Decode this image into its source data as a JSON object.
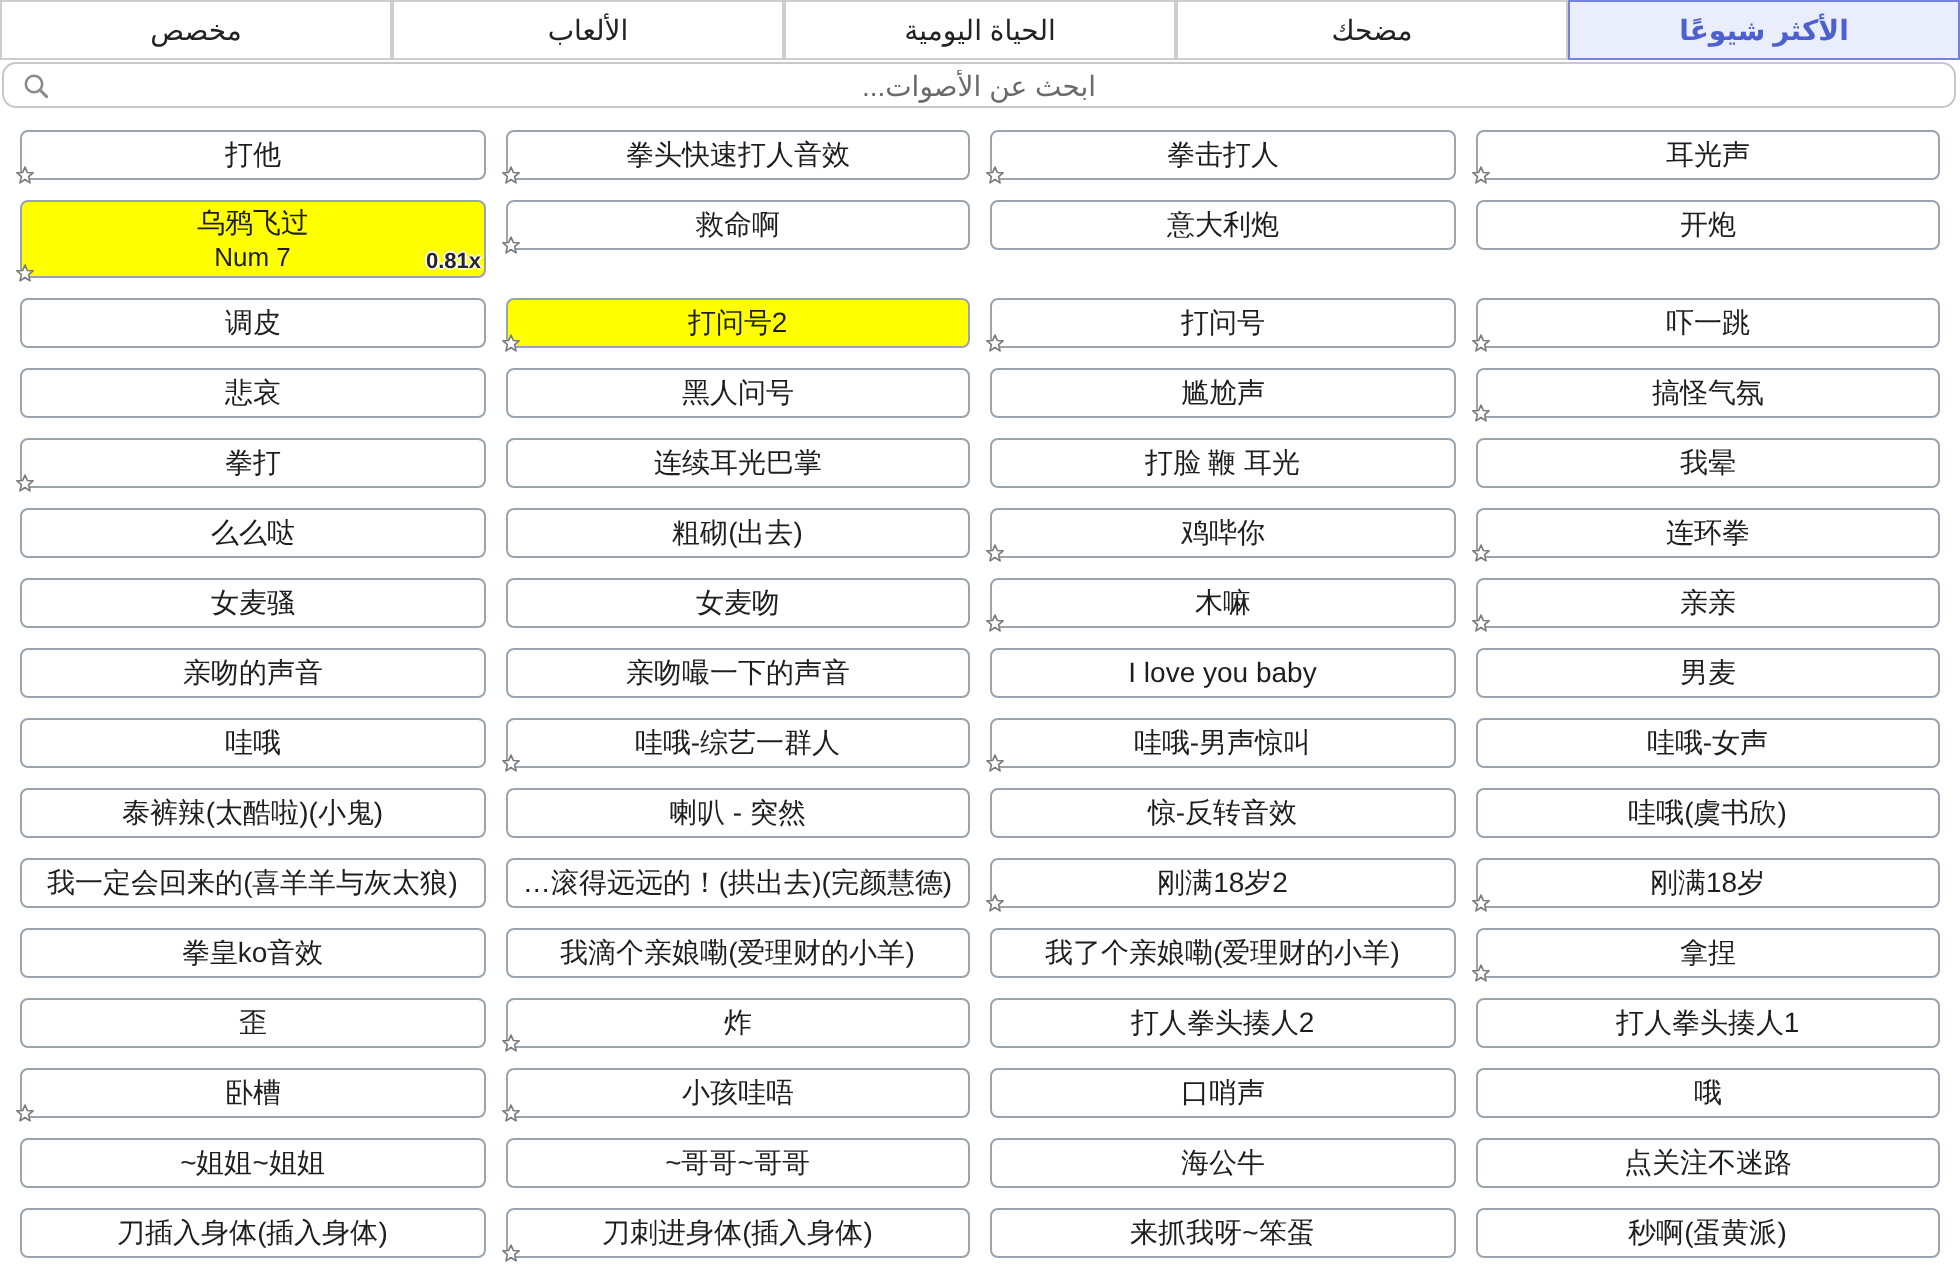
{
  "tabs": [
    {
      "label": "الأكثر شيوعًا",
      "selected": true
    },
    {
      "label": "مضحك",
      "selected": false
    },
    {
      "label": "الحياة اليومية",
      "selected": false
    },
    {
      "label": "الألعاب",
      "selected": false
    },
    {
      "label": "مخصص",
      "selected": false
    }
  ],
  "search": {
    "placeholder": "ابحث عن الأصوات..."
  },
  "sounds": [
    {
      "label": "打他",
      "starred": true,
      "selected": false
    },
    {
      "label": "拳头快速打人音效",
      "starred": true,
      "selected": false
    },
    {
      "label": "拳击打人",
      "starred": true,
      "selected": false
    },
    {
      "label": "耳光声",
      "starred": true,
      "selected": false
    },
    {
      "label": "乌鸦飞过",
      "starred": true,
      "selected": true,
      "hotkey": "Num 7",
      "speed": "0.81x"
    },
    {
      "label": "救命啊",
      "starred": true,
      "selected": false
    },
    {
      "label": "意大利炮",
      "starred": false,
      "selected": false
    },
    {
      "label": "开炮",
      "starred": false,
      "selected": false
    },
    {
      "label": "调皮",
      "starred": false,
      "selected": false
    },
    {
      "label": "打问号2",
      "starred": true,
      "selected": true
    },
    {
      "label": "打问号",
      "starred": true,
      "selected": false
    },
    {
      "label": "吓一跳",
      "starred": true,
      "selected": false
    },
    {
      "label": "悲哀",
      "starred": false,
      "selected": false
    },
    {
      "label": "黑人问号",
      "starred": false,
      "selected": false
    },
    {
      "label": "尴尬声",
      "starred": false,
      "selected": false
    },
    {
      "label": "搞怪气氛",
      "starred": true,
      "selected": false
    },
    {
      "label": "拳打",
      "starred": true,
      "selected": false
    },
    {
      "label": "连续耳光巴掌",
      "starred": false,
      "selected": false
    },
    {
      "label": "打脸 鞭 耳光",
      "starred": false,
      "selected": false
    },
    {
      "label": "我晕",
      "starred": false,
      "selected": false
    },
    {
      "label": "么么哒",
      "starred": false,
      "selected": false
    },
    {
      "label": "粗砌(出去)",
      "starred": false,
      "selected": false
    },
    {
      "label": "鸡哔你",
      "starred": true,
      "selected": false
    },
    {
      "label": "连环拳",
      "starred": true,
      "selected": false
    },
    {
      "label": "女麦骚",
      "starred": false,
      "selected": false
    },
    {
      "label": "女麦吻",
      "starred": false,
      "selected": false
    },
    {
      "label": "木嘛",
      "starred": true,
      "selected": false
    },
    {
      "label": "亲亲",
      "starred": true,
      "selected": false
    },
    {
      "label": "亲吻的声音",
      "starred": false,
      "selected": false
    },
    {
      "label": "亲吻嘬一下的声音",
      "starred": false,
      "selected": false
    },
    {
      "label": "I love you baby",
      "starred": false,
      "selected": false
    },
    {
      "label": "男麦",
      "starred": false,
      "selected": false
    },
    {
      "label": "哇哦",
      "starred": false,
      "selected": false
    },
    {
      "label": "哇哦-综艺一群人",
      "starred": true,
      "selected": false
    },
    {
      "label": "哇哦-男声惊叫",
      "starred": true,
      "selected": false
    },
    {
      "label": "哇哦-女声",
      "starred": false,
      "selected": false
    },
    {
      "label": "泰裤辣(太酷啦)(小鬼)",
      "starred": false,
      "selected": false
    },
    {
      "label": "喇叭 - 突然",
      "starred": false,
      "selected": false
    },
    {
      "label": "惊-反转音效",
      "starred": false,
      "selected": false
    },
    {
      "label": "哇哦(虞书欣)",
      "starred": false,
      "selected": false
    },
    {
      "label": "我一定会回来的(喜羊羊与灰太狼)",
      "starred": false,
      "selected": false
    },
    {
      "label": "…滚得远远的！(拱出去)(完颜慧德)",
      "starred": false,
      "selected": false
    },
    {
      "label": "刚满18岁2",
      "starred": true,
      "selected": false
    },
    {
      "label": "刚满18岁",
      "starred": true,
      "selected": false
    },
    {
      "label": "拳皇ko音效",
      "starred": false,
      "selected": false
    },
    {
      "label": "我滴个亲娘嘞(爱理财的小羊)",
      "starred": false,
      "selected": false
    },
    {
      "label": "我了个亲娘嘞(爱理财的小羊)",
      "starred": false,
      "selected": false
    },
    {
      "label": "拿捏",
      "starred": true,
      "selected": false
    },
    {
      "label": "歪",
      "starred": false,
      "selected": false
    },
    {
      "label": "炸",
      "starred": true,
      "selected": false
    },
    {
      "label": "打人拳头揍人2",
      "starred": false,
      "selected": false
    },
    {
      "label": "打人拳头揍人1",
      "starred": false,
      "selected": false
    },
    {
      "label": "卧槽",
      "starred": true,
      "selected": false
    },
    {
      "label": "小孩哇唔",
      "starred": true,
      "selected": false
    },
    {
      "label": "口哨声",
      "starred": false,
      "selected": false
    },
    {
      "label": "哦",
      "starred": false,
      "selected": false
    },
    {
      "label": "~姐姐~姐姐",
      "starred": false,
      "selected": false
    },
    {
      "label": "~哥哥~哥哥",
      "starred": false,
      "selected": false
    },
    {
      "label": "海公牛",
      "starred": false,
      "selected": false
    },
    {
      "label": "点关注不迷路",
      "starred": false,
      "selected": false
    },
    {
      "label": "刀插入身体(插入身体)",
      "starred": false,
      "selected": false
    },
    {
      "label": "刀刺进身体(插入身体)",
      "starred": true,
      "selected": false
    },
    {
      "label": "来抓我呀~笨蛋",
      "starred": false,
      "selected": false
    },
    {
      "label": "秒啊(蛋黄派)",
      "starred": false,
      "selected": false
    }
  ]
}
